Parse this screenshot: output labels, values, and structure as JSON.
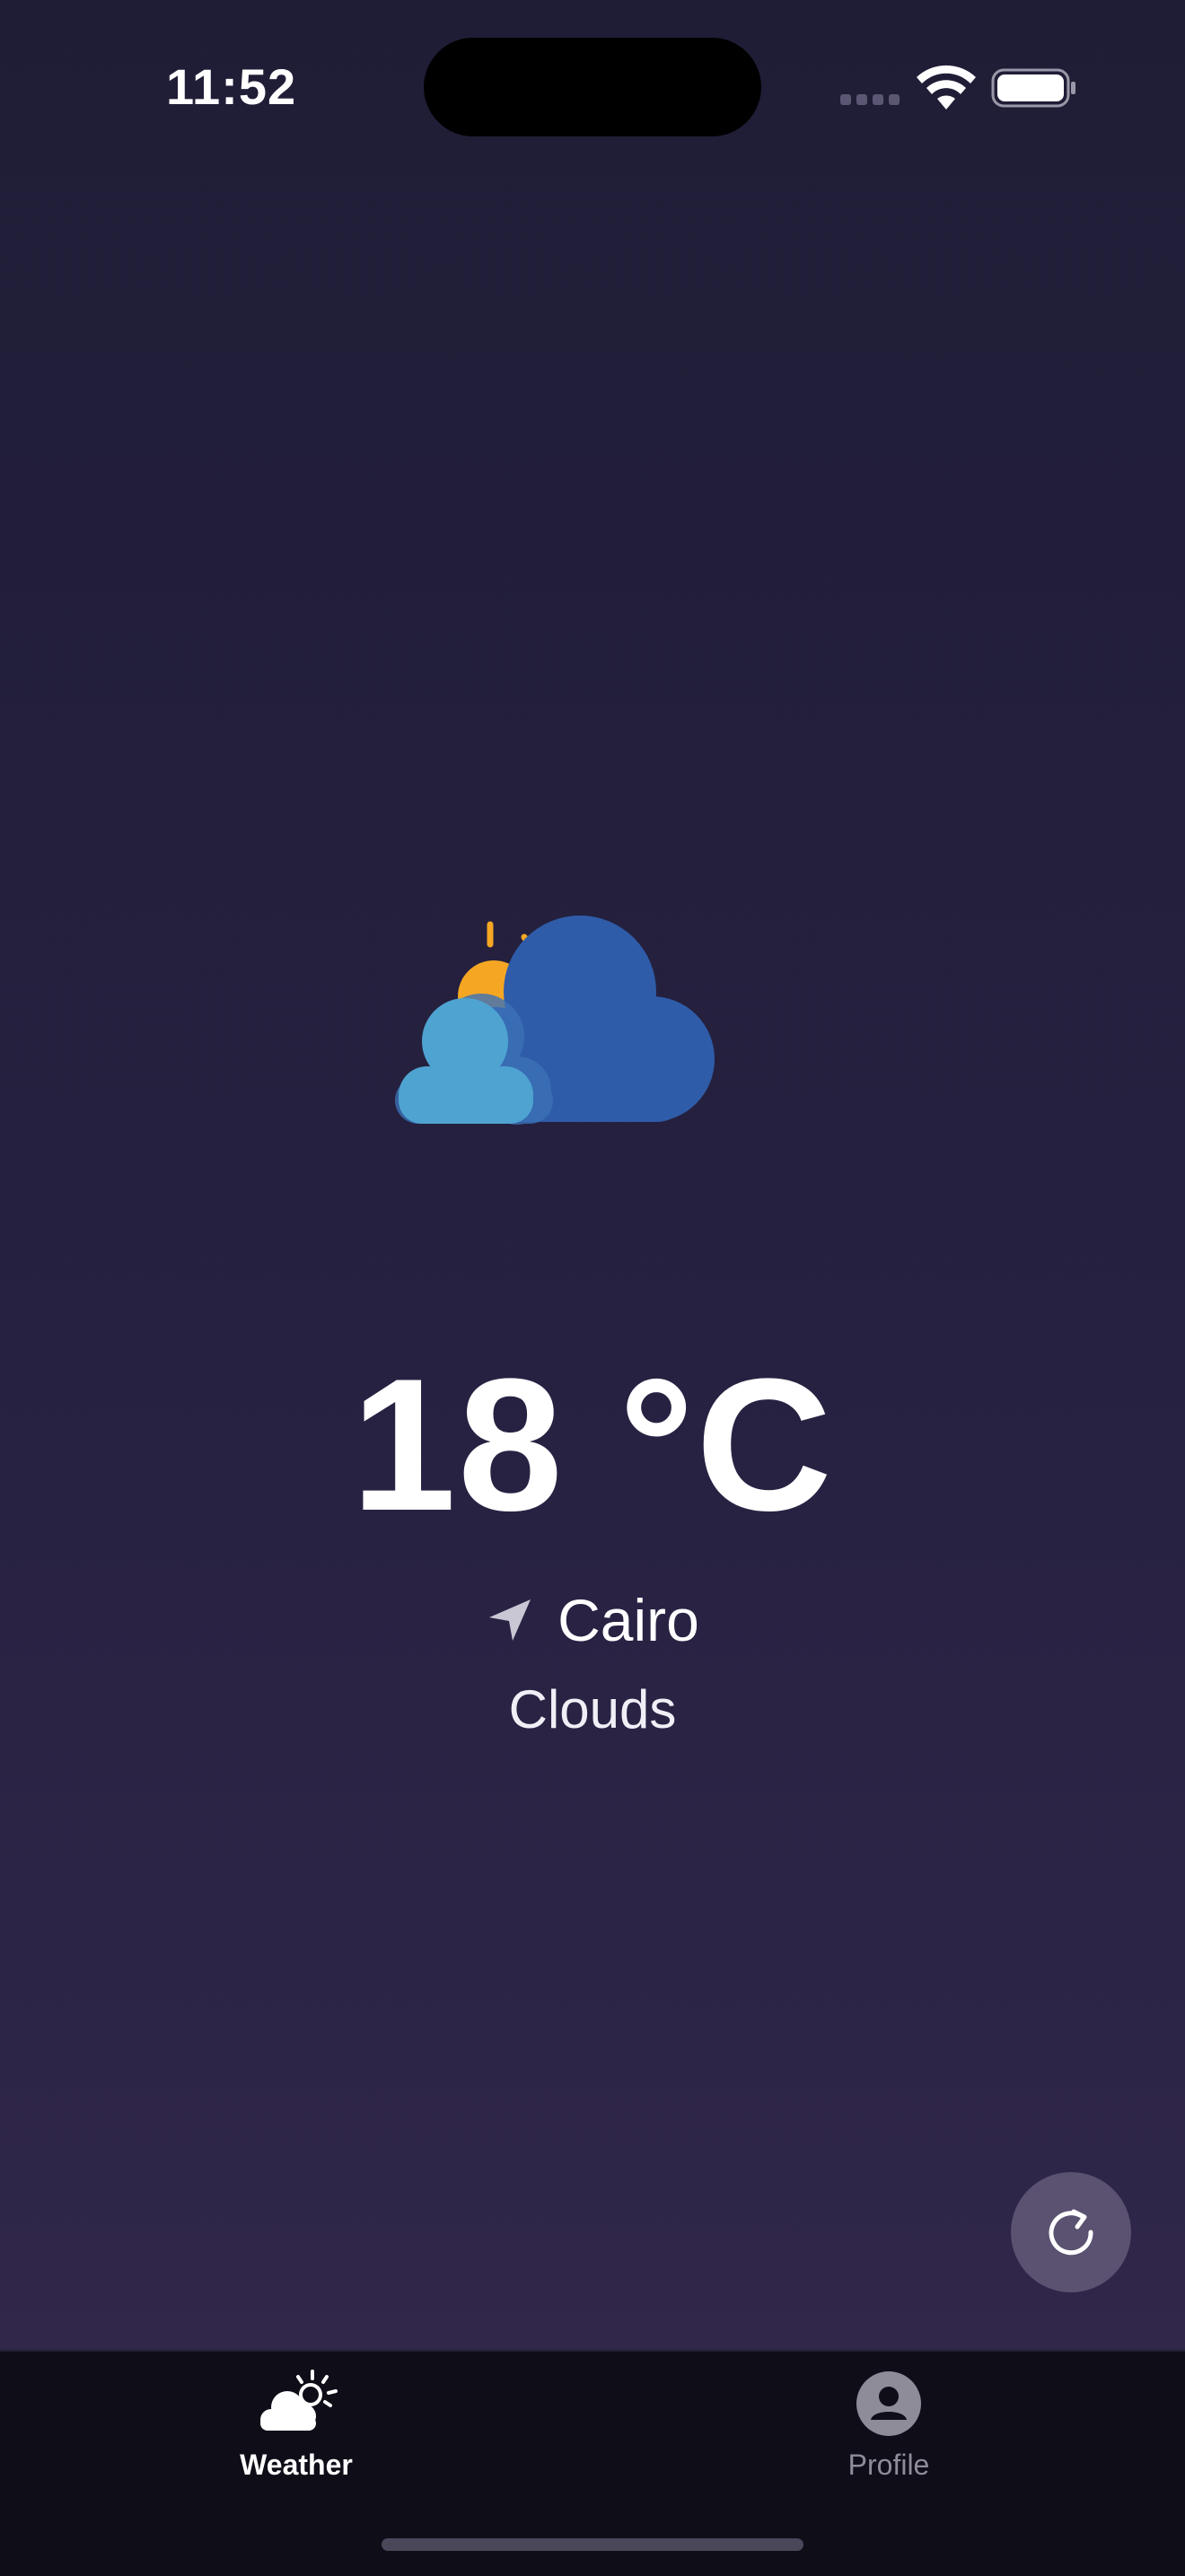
{
  "status_bar": {
    "time": "11:52",
    "icons": [
      "cellular-signal-icon",
      "wifi-icon",
      "battery-icon"
    ]
  },
  "weather": {
    "icon": "partly-cloudy-icon",
    "temperature": "18 °C",
    "location": "Cairo",
    "location_icon": "location-arrow-icon",
    "condition": "Clouds"
  },
  "refresh_button": {
    "icon": "refresh-icon"
  },
  "tab_bar": {
    "tabs": [
      {
        "label": "Weather",
        "icon": "weather-icon",
        "active": true
      },
      {
        "label": "Profile",
        "icon": "profile-icon",
        "active": false
      }
    ]
  },
  "colors": {
    "background_top": "#1f1d36",
    "background_bottom": "#332a4e",
    "tab_active": "#ffffff",
    "tab_inactive": "#8e8c98",
    "cloud_front": "#4fa3d1",
    "cloud_back": "#2f5ca8",
    "sun": "#f5a623",
    "refresh_button_bg": "#5a5270"
  }
}
